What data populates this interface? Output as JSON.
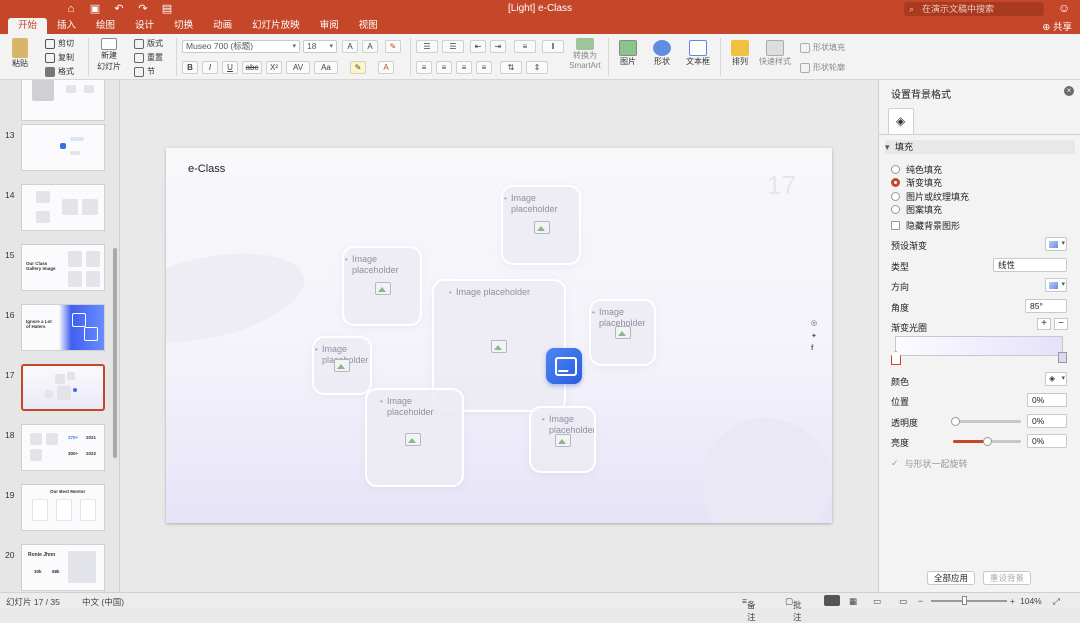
{
  "window": {
    "title": "[Light] e-Class",
    "search_placeholder": "在演示文稿中搜索"
  },
  "tabs": [
    {
      "label": "开始",
      "active": true
    },
    {
      "label": "插入"
    },
    {
      "label": "绘图"
    },
    {
      "label": "设计"
    },
    {
      "label": "切换"
    },
    {
      "label": "动画"
    },
    {
      "label": "幻灯片放映"
    },
    {
      "label": "审阅"
    },
    {
      "label": "视图"
    }
  ],
  "share_label": "共享",
  "ribbon": {
    "paste": "粘贴",
    "cut": "剪切",
    "copy": "复制",
    "format": "格式",
    "new_slide_1": "新建",
    "new_slide_2": "幻灯片",
    "layout": "版式",
    "reset": "重置",
    "section": "节",
    "font_name": "Museo 700 (标题)",
    "font_size": "18",
    "convert_1": "转换为",
    "convert_2": "SmartArt",
    "picture": "图片",
    "shape": "形状",
    "textbox": "文本框",
    "arrange": "排列",
    "quick_styles": "快速样式",
    "shape_fill": "形状填充",
    "shape_outline": "形状轮廓",
    "bold": "B",
    "italic": "I",
    "underline": "U",
    "strike": "abc",
    "superscript": "X²",
    "spacing": "AV",
    "case": "Aa"
  },
  "thumbnails": [
    {
      "num": "13"
    },
    {
      "num": "14"
    },
    {
      "num": "15",
      "text": "Our Class Gallery Image"
    },
    {
      "num": "16",
      "text": "Ignore a Lot of Haters"
    },
    {
      "num": "17",
      "selected": true
    },
    {
      "num": "18",
      "a": "270+",
      "b": "2021",
      "c": "300+",
      "d": "2022"
    },
    {
      "num": "19",
      "text": "Our Best Mentor"
    },
    {
      "num": "20",
      "text": "Ronie Jhnn",
      "a": "30k",
      "b": "68k"
    }
  ],
  "slide": {
    "title": "e-Class",
    "number": "17",
    "placeholders": [
      "Image placeholder",
      "Image placeholder",
      "Image placeholder",
      "Image placeholder",
      "Image placeholder",
      "Image placeholder",
      "Image placeholder"
    ],
    "social": [
      "instagram-icon",
      "twitter-icon",
      "facebook-icon"
    ]
  },
  "panel": {
    "title": "设置背景格式",
    "section": "填充",
    "fill_options": [
      "纯色填充",
      "渐变填充",
      "图片或纹理填充",
      "图案填充"
    ],
    "selected_fill": "渐变填充",
    "hide_bg": "隐藏背景图形",
    "preset": "预设渐变",
    "type_label": "类型",
    "type_value": "线性",
    "direction": "方向",
    "angle_label": "角度",
    "angle_value": "85°",
    "stops_label": "渐变光圈",
    "color_label": "颜色",
    "position_label": "位置",
    "position_value": "0%",
    "transparency_label": "透明度",
    "transparency_value": "0%",
    "brightness_label": "亮度",
    "brightness_value": "0%",
    "rotate_with_shape": "与形状一起旋转",
    "apply_all": "全部应用",
    "reset_bg": "重设背景"
  },
  "status": {
    "slide_count": "幻灯片 17 / 35",
    "language": "中文 (中国)",
    "notes": "备注",
    "comments": "批注",
    "zoom": "104%"
  },
  "colors": {
    "accent": "#c5472a",
    "slide_icon": "#3a6fe8"
  }
}
